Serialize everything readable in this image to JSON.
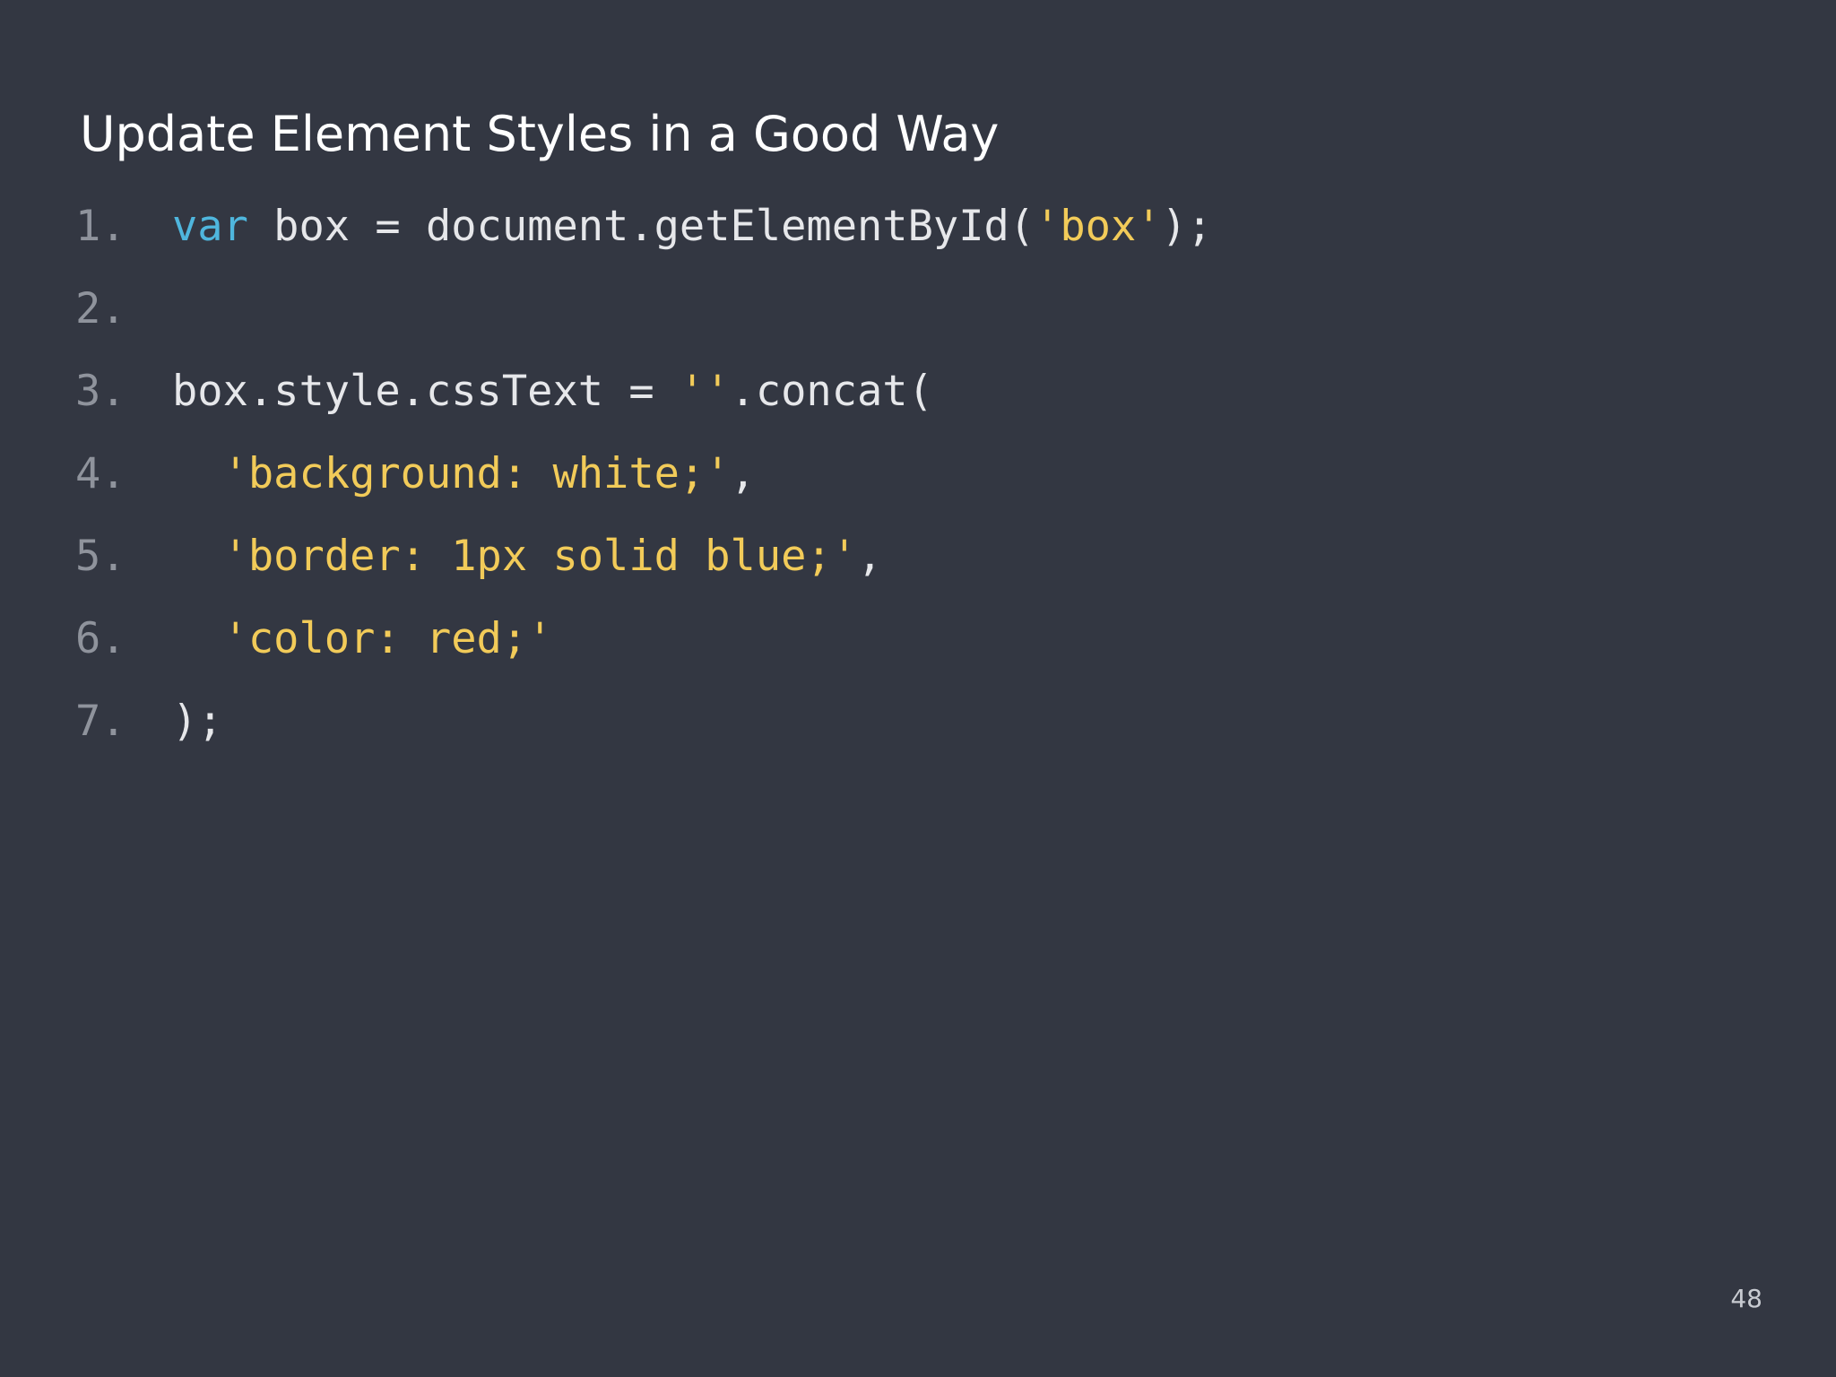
{
  "slide": {
    "title": "Update Element Styles in a Good Way",
    "page_number": "48"
  },
  "code": {
    "line_numbers": [
      "1.",
      "2.",
      "3.",
      "4.",
      "5.",
      "6.",
      "7."
    ],
    "line1": {
      "keyword": "var",
      "text_a": " box = document.getElementById(",
      "string": "'box'",
      "text_b": ");"
    },
    "line3": {
      "text_a": "box.style.cssText = ",
      "string": "''",
      "text_b": ".concat("
    },
    "line4": {
      "indent": "  ",
      "string": "'background: white;'",
      "text": ","
    },
    "line5": {
      "indent": "  ",
      "string": "'border: 1px solid blue;'",
      "text": ","
    },
    "line6": {
      "indent": "  ",
      "string": "'color: red;'"
    },
    "line7": {
      "text": ");"
    }
  },
  "colors": {
    "background": "#333742",
    "keyword": "#4fb6dd",
    "string": "#f2cb59",
    "text": "#e6e7ea",
    "line_number": "#8f939c"
  }
}
